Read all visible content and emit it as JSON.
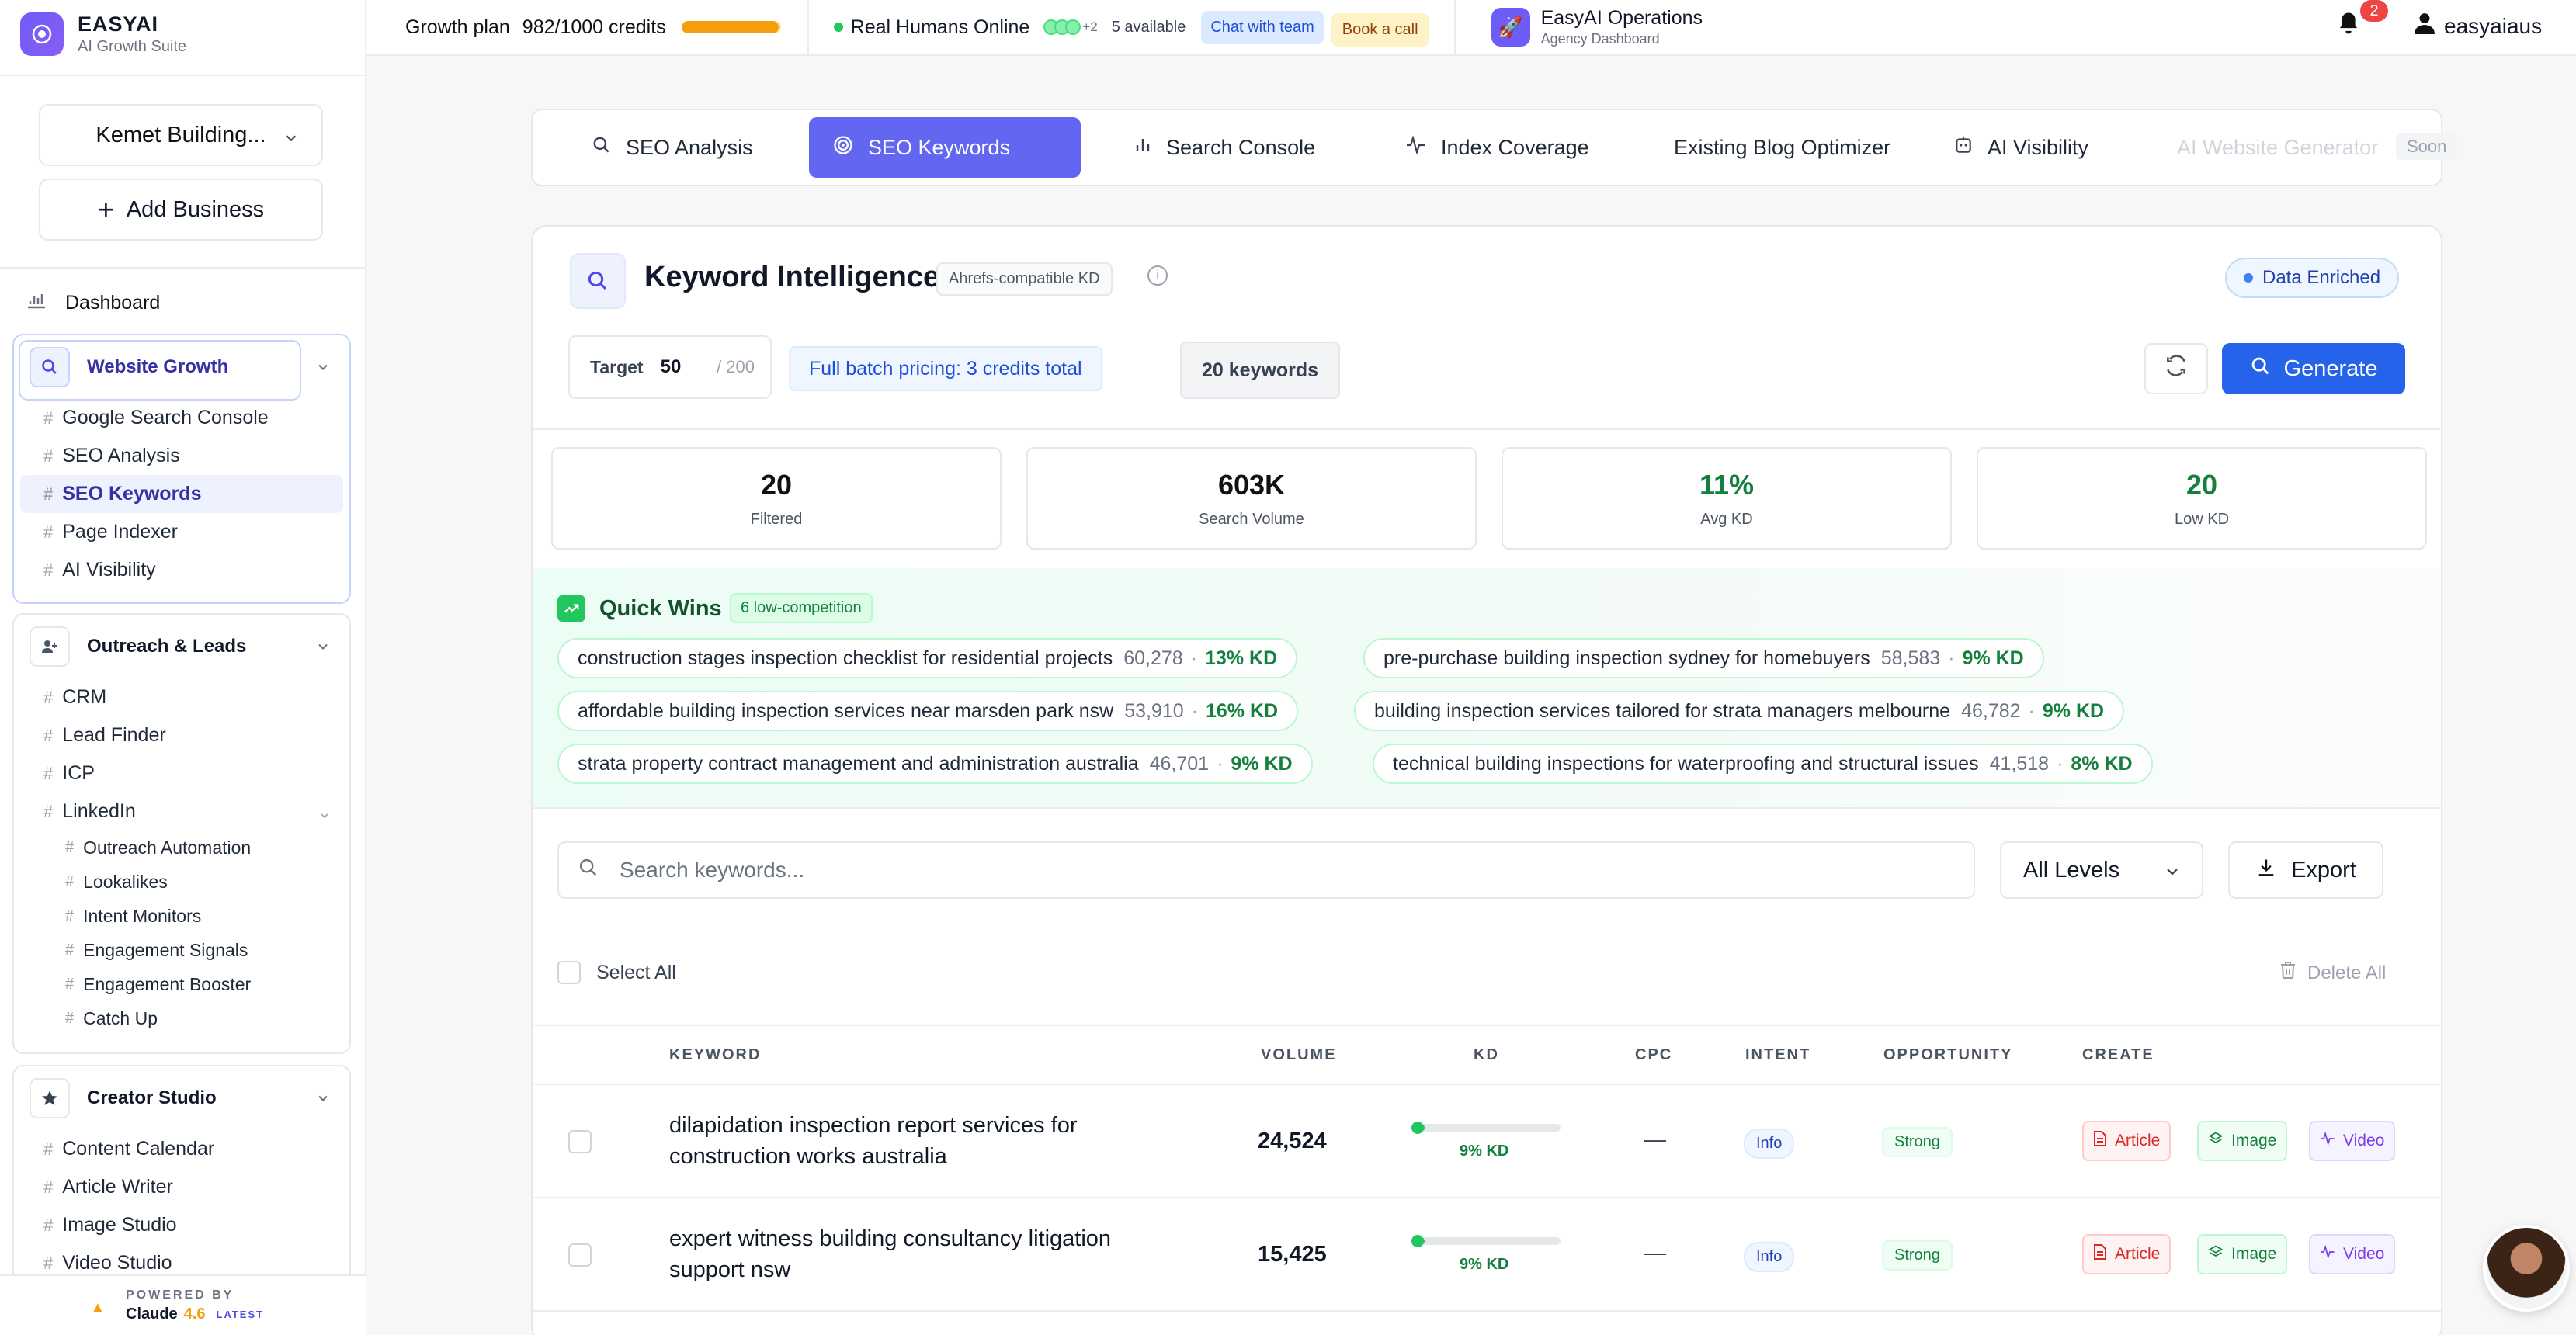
{
  "brand": {
    "name": "EASYAI",
    "sub": "AI Growth Suite"
  },
  "sidebar": {
    "business": "Kemet Building...",
    "add_business": "Add Business",
    "dashboard": "Dashboard",
    "groups": [
      {
        "label": "Website Growth",
        "items": [
          "Google Search Console",
          "SEO Analysis",
          "SEO Keywords",
          "Page Indexer",
          "AI Visibility"
        ],
        "current": "SEO Keywords"
      },
      {
        "label": "Outreach & Leads",
        "items": [
          "CRM",
          "Lead Finder",
          "ICP",
          "LinkedIn"
        ],
        "linkedin_items": [
          "Outreach Automation",
          "Lookalikes",
          "Intent Monitors",
          "Engagement Signals",
          "Engagement Booster",
          "Catch Up"
        ]
      },
      {
        "label": "Creator Studio",
        "items": [
          "Content Calendar",
          "Article Writer",
          "Image Studio",
          "Video Studio"
        ]
      }
    ],
    "powered": {
      "label": "POWERED BY",
      "model": "Claude",
      "version": "4.6",
      "tag": "LATEST"
    }
  },
  "topbar": {
    "plan": "Growth plan",
    "credits": "982/1000 credits",
    "credits_fraction": 0.982,
    "humans": "Real Humans Online",
    "humans_extra": "+2",
    "available": "5 available",
    "chat": "Chat with team",
    "book": "Book a call",
    "agency_name": "EasyAI Operations",
    "agency_sub": "Agency Dashboard",
    "notifications": "2",
    "user": "easyaiaus"
  },
  "tabs": [
    {
      "label": "SEO Analysis",
      "icon": "search-icon"
    },
    {
      "label": "SEO Keywords",
      "icon": "target-icon",
      "active": true
    },
    {
      "label": "Search Console",
      "icon": "bar-chart-icon"
    },
    {
      "label": "Index Coverage",
      "icon": "activity-icon"
    },
    {
      "label": "Existing Blog Optimizer",
      "icon": ""
    },
    {
      "label": "AI Visibility",
      "icon": "bot-icon"
    },
    {
      "label": "AI Website Generator",
      "icon": "",
      "disabled": true,
      "badge": "Soon"
    }
  ],
  "ki": {
    "title": "Keyword Intelligence",
    "tag": "Ahrefs-compatible KD",
    "enriched": "Data Enriched",
    "target_label": "Target",
    "target_value": "50",
    "target_max": "/ 200",
    "batch": "Full batch pricing: 3 credits total",
    "kw_count": "20 keywords",
    "generate": "Generate"
  },
  "stats": [
    {
      "value": "20",
      "label": "Filtered",
      "color": "#111111"
    },
    {
      "value": "603K",
      "label": "Search Volume",
      "color": "#111111"
    },
    {
      "value": "11%",
      "label": "Avg KD",
      "color": "#15803d"
    },
    {
      "value": "20",
      "label": "Low KD",
      "color": "#15803d"
    }
  ],
  "quick_wins": {
    "title": "Quick Wins",
    "count": "6 low-competition",
    "chips": [
      {
        "kw": "construction stages inspection checklist for residential projects",
        "vol": "60,278",
        "kd": "13% KD"
      },
      {
        "kw": "pre-purchase building inspection sydney for homebuyers",
        "vol": "58,583",
        "kd": "9% KD"
      },
      {
        "kw": "affordable building inspection services near marsden park nsw",
        "vol": "53,910",
        "kd": "16% KD"
      },
      {
        "kw": "building inspection services tailored for strata managers melbourne",
        "vol": "46,782",
        "kd": "9% KD"
      },
      {
        "kw": "strata property contract management and administration australia",
        "vol": "46,701",
        "kd": "9% KD"
      },
      {
        "kw": "technical building inspections for waterproofing and structural issues",
        "vol": "41,518",
        "kd": "8% KD"
      }
    ]
  },
  "search": {
    "placeholder": "Search keywords...",
    "levels": "All Levels",
    "export": "Export"
  },
  "select_all": "Select All",
  "delete_all": "Delete All",
  "table": {
    "headers": [
      "KEYWORD",
      "VOLUME",
      "KD",
      "CPC",
      "INTENT",
      "OPPORTUNITY",
      "CREATE"
    ],
    "rows": [
      {
        "keyword": "dilapidation inspection report services for construction works australia",
        "volume": "24,524",
        "kd": "9% KD",
        "kd_value": 0.09,
        "cpc": "—",
        "intent": "Info",
        "opportunity": "Strong"
      },
      {
        "keyword": "expert witness building consultancy litigation support nsw",
        "volume": "15,425",
        "kd": "9% KD",
        "kd_value": 0.09,
        "cpc": "—",
        "intent": "Info",
        "opportunity": "Strong"
      }
    ],
    "create": {
      "article": "Article",
      "image": "Image",
      "video": "Video"
    }
  }
}
